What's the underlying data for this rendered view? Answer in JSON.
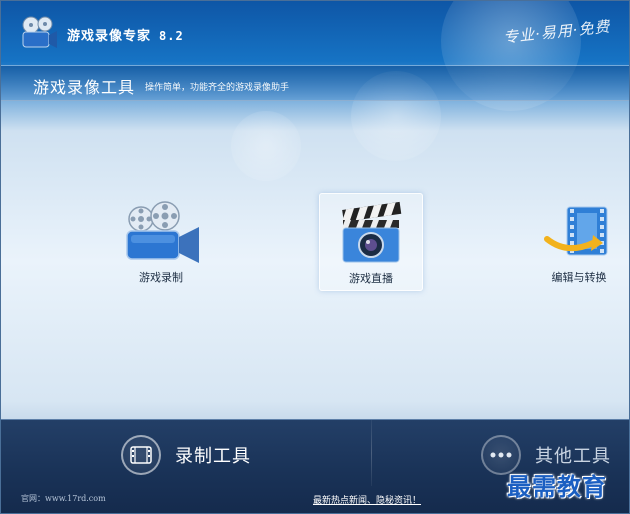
{
  "app": {
    "title": "游戏录像专家",
    "version": "8.2",
    "slogan": "专业·易用·免费"
  },
  "header": {
    "title": "游戏录像工具",
    "subtitle": "操作简单，功能齐全的游戏录像助手"
  },
  "tools": [
    {
      "label": "游戏录制",
      "icon": "film-camera-icon",
      "selected": false
    },
    {
      "label": "游戏直播",
      "icon": "clapperboard-camera-icon",
      "selected": true
    },
    {
      "label": "编辑与转换",
      "icon": "film-convert-icon",
      "selected": false
    }
  ],
  "bottom": {
    "record_tools_label": "录制工具",
    "other_tools_label": "其他工具"
  },
  "footer": {
    "official_site": "官网：www.17rd.com",
    "news_link": "最新热点新闻、隐秘资讯！"
  },
  "watermark": "最需教育",
  "colors": {
    "title_bar": "#0e56a6",
    "bottom_bar": "#1a3358",
    "watermark": "#1b5fc2"
  }
}
